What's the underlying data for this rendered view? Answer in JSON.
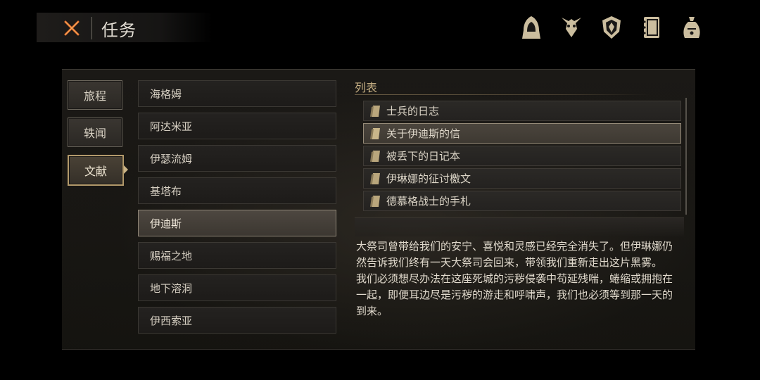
{
  "header": {
    "title": "任务",
    "close_icon": "close-x-icon",
    "accent": "#e06a2a"
  },
  "top_icons": [
    {
      "name": "hooded-figure-icon"
    },
    {
      "name": "beast-head-icon"
    },
    {
      "name": "mask-shield-icon"
    },
    {
      "name": "journal-book-icon"
    },
    {
      "name": "pouch-bag-icon"
    }
  ],
  "tabs": [
    {
      "label": "旅程",
      "active": false
    },
    {
      "label": "轶闻",
      "active": false
    },
    {
      "label": "文献",
      "active": true
    }
  ],
  "regions": [
    {
      "label": "海格姆",
      "active": false
    },
    {
      "label": "阿达米亚",
      "active": false
    },
    {
      "label": "伊瑟流姆",
      "active": false
    },
    {
      "label": "基塔布",
      "active": false
    },
    {
      "label": "伊迪斯",
      "active": true
    },
    {
      "label": "赐福之地",
      "active": false
    },
    {
      "label": "地下溶洞",
      "active": false
    },
    {
      "label": "伊西索亚",
      "active": false
    }
  ],
  "documents": {
    "title": "列表",
    "items": [
      {
        "label": "士兵的日志",
        "active": false
      },
      {
        "label": "关于伊迪斯的信",
        "active": true
      },
      {
        "label": "被丢下的日记本",
        "active": false
      },
      {
        "label": "伊琳娜的征讨檄文",
        "active": false
      },
      {
        "label": "德慕格战士的手札",
        "active": false
      }
    ]
  },
  "description": {
    "paragraph1": "大祭司曾带给我们的安宁、喜悦和灵感已经完全消失了。但伊琳娜仍然告诉我们终有一天大祭司会回来，带领我们重新走出这片黑雾。",
    "paragraph2": "我们必须想尽办法在这座死城的污秽侵袭中苟延残喘，蜷缩或拥抱在一起，即便耳边尽是污秽的游走和呼啸声，我们也必须等到那一天的到来。"
  }
}
